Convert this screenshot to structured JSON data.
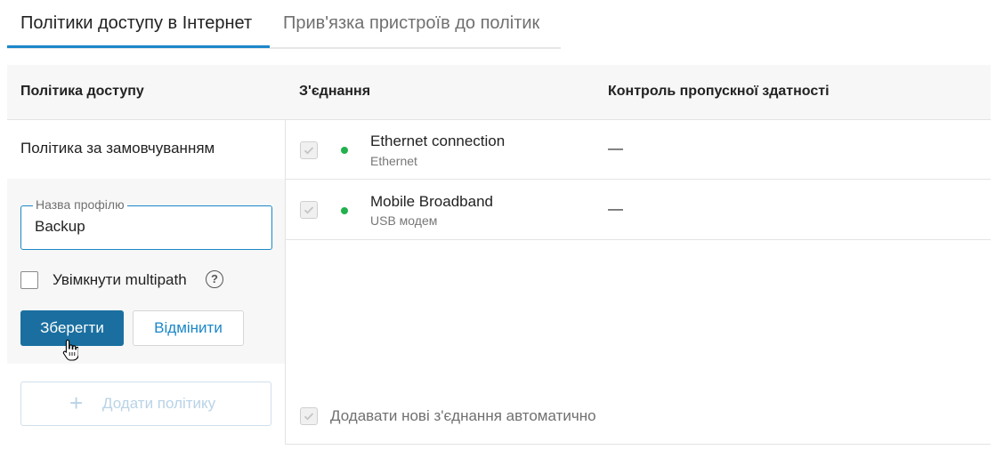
{
  "tabs": [
    {
      "label": "Політики доступу в Інтернет",
      "active": true
    },
    {
      "label": "Прив'язка пристроїв до політик",
      "active": false
    }
  ],
  "table": {
    "headers": [
      "Політика доступу",
      "З'єднання",
      "Контроль пропускної здатності"
    ],
    "default_policy": "Політика за замовчуванням",
    "connections": [
      {
        "name": "Ethernet connection",
        "type": "Ethernet",
        "enabled": true,
        "status_color": "#22b14c",
        "bandwidth": "—"
      },
      {
        "name": "Mobile Broadband",
        "type": "USB модем",
        "enabled": true,
        "status_color": "#22b14c",
        "bandwidth": "—"
      }
    ],
    "auto_add_label": "Додавати нові з'єднання автоматично"
  },
  "editor": {
    "field_label": "Назва профілю",
    "field_value": "Backup",
    "multipath_label": "Увімкнути multipath",
    "multipath_checked": false,
    "help_glyph": "?",
    "save_label": "Зберегти",
    "cancel_label": "Відмінити"
  },
  "add_policy": {
    "label": "Додати політику",
    "icon": "plus-icon",
    "disabled": true
  },
  "colors": {
    "accent": "#1b87c9",
    "primary_button": "#1a6fa0",
    "header_bg": "#f7f7f7"
  }
}
